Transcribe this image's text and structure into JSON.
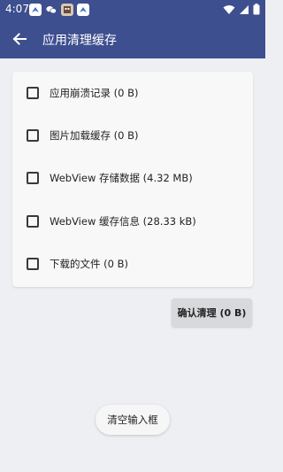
{
  "status_bar": {
    "time": "4:07",
    "notification_icons": [
      "bird-app-icon",
      "wechat-icon",
      "game-avatar-icon",
      "bird-app-icon"
    ],
    "right_icons": [
      "wifi-icon",
      "signal-icon",
      "battery-icon"
    ]
  },
  "app_bar": {
    "title": "应用清理缓存",
    "back_icon": "arrow-left-icon"
  },
  "options": [
    {
      "label": "应用崩溃记录 (0 B)",
      "checked": false
    },
    {
      "label": "图片加载缓存 (0 B)",
      "checked": false
    },
    {
      "label": "WebView 存储数据 (4.32 MB)",
      "checked": false
    },
    {
      "label": "WebView 缓存信息 (28.33 kB)",
      "checked": false
    },
    {
      "label": "下载的文件 (0 B)",
      "checked": false
    }
  ],
  "confirm_button": {
    "label": "确认清理 (0 B)"
  },
  "clear_input_button": {
    "label": "清空输入框"
  },
  "colors": {
    "app_bar": "#3e4f8f",
    "background": "#eeeff2",
    "card": "#f8f8f9",
    "button": "#d8d9dc"
  }
}
